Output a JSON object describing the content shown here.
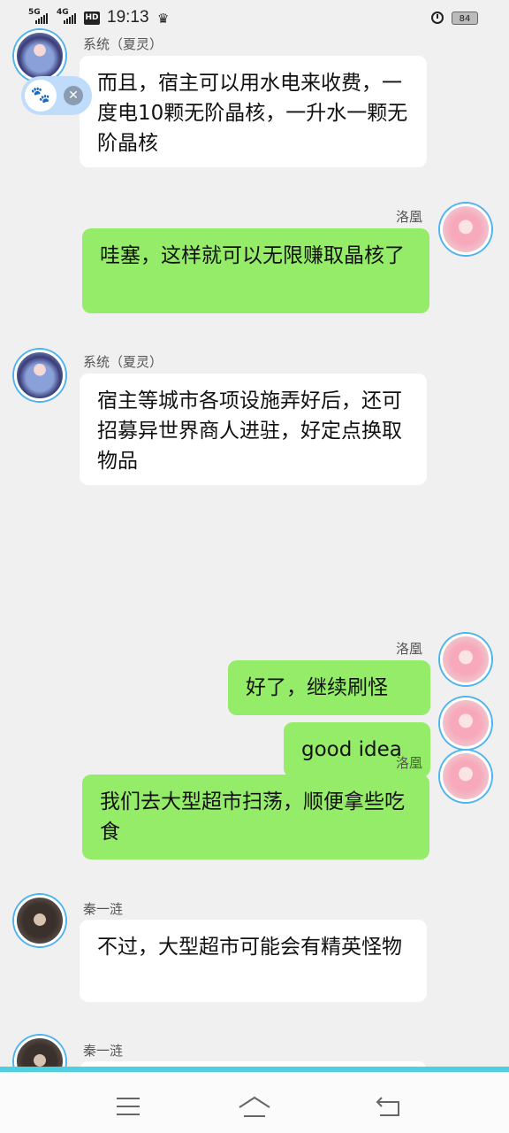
{
  "status_bar": {
    "network_1": "5G",
    "network_2": "4G",
    "hd_badge": "HD",
    "time": "19:13",
    "battery": "84",
    "icons": [
      "crown-icon",
      "alarm-icon"
    ]
  },
  "floating_widget": {
    "icons": [
      "paw-icon",
      "close-icon"
    ],
    "close_glyph": "✕"
  },
  "messages": [
    {
      "sender": "系统（夏灵）",
      "text": "而且，宿主可以用水电来收费，一度电10颗无阶晶核，一升水一颗无阶晶核",
      "side": "left"
    },
    {
      "sender": "洛凰",
      "text": "哇塞，这样就可以无限赚取晶核了",
      "side": "right"
    },
    {
      "sender": "系统（夏灵）",
      "text": "宿主等城市各项设施弄好后，还可招募异世界商人进驻，好定点换取物品",
      "side": "left"
    },
    {
      "sender": "洛凰",
      "text": "好了，继续刷怪",
      "side": "right"
    },
    {
      "sender": "洛凰",
      "text": "good idea",
      "side": "right"
    },
    {
      "sender": "洛凰",
      "text": "我们去大型超市扫荡，顺便拿些吃食",
      "side": "right"
    },
    {
      "sender": "秦一涟",
      "text": "不过，大型超市可能会有精英怪物",
      "side": "left"
    },
    {
      "sender": "秦一涟",
      "text": "",
      "side": "left"
    }
  ],
  "nav_bar": {
    "buttons": [
      "menu-icon",
      "home-icon",
      "back-icon"
    ]
  },
  "colors": {
    "background": "#f0f0f0",
    "bubble_left": "#ffffff",
    "bubble_right": "#95ec69",
    "avatar_ring": "#4db4ee",
    "nav_accent": "#4ed0e0"
  }
}
